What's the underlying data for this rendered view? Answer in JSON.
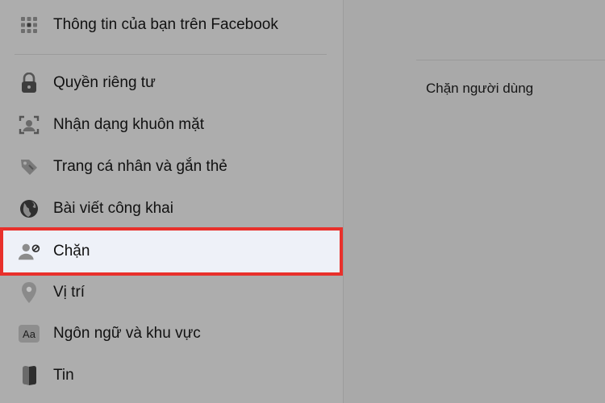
{
  "sidebar": {
    "top_item": {
      "label": "Thông tin của bạn trên Facebook",
      "icon": "grid-icon"
    },
    "items": [
      {
        "label": "Quyền riêng tư",
        "icon": "lock-icon"
      },
      {
        "label": "Nhận dạng khuôn mặt",
        "icon": "face-scan-icon"
      },
      {
        "label": "Trang cá nhân và gắn thẻ",
        "icon": "tag-icon"
      },
      {
        "label": "Bài viết công khai",
        "icon": "globe-icon"
      },
      {
        "label": "Chặn",
        "icon": "block-user-icon",
        "selected": true
      },
      {
        "label": "Vị trí",
        "icon": "location-pin-icon"
      },
      {
        "label": "Ngôn ngữ và khu vực",
        "icon": "language-icon"
      },
      {
        "label": "Tin",
        "icon": "story-book-icon"
      }
    ]
  },
  "main": {
    "heading": "Chặn người dùng"
  },
  "colors": {
    "highlight_border": "#e8302b",
    "selected_background": "#eef1f8"
  }
}
